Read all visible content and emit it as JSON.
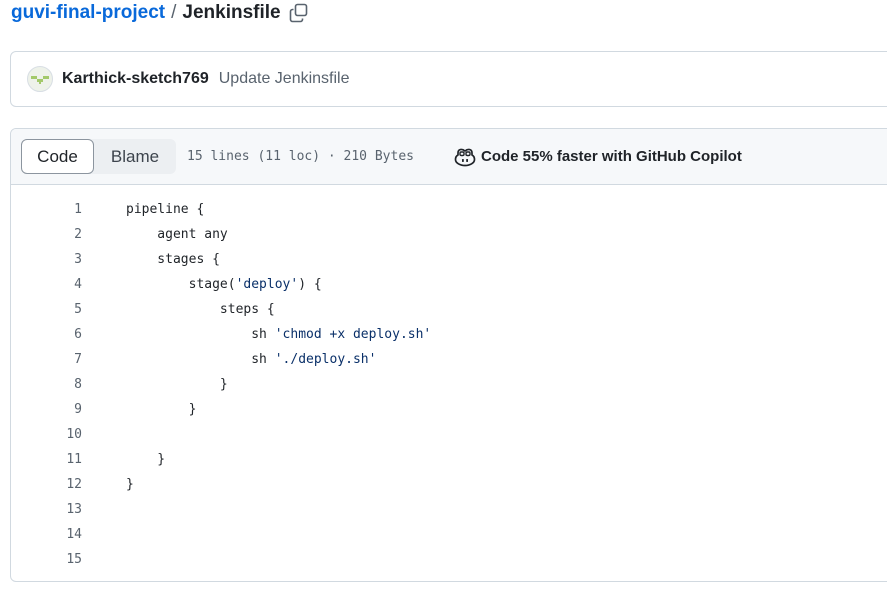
{
  "breadcrumb": {
    "repo": "guvi-final-project",
    "separator": "/",
    "file": "Jenkinsfile"
  },
  "commit": {
    "author": "Karthick-sketch769",
    "message": "Update Jenkinsfile"
  },
  "file_header": {
    "tabs": [
      "Code",
      "Blame"
    ],
    "active_tab": "Code",
    "meta": "15 lines (11 loc) · 210 Bytes",
    "copilot": "Code 55% faster with GitHub Copilot"
  },
  "code_lines": [
    {
      "n": "1",
      "parts": [
        {
          "t": "pipeline {"
        }
      ]
    },
    {
      "n": "2",
      "parts": [
        {
          "t": "    agent any"
        }
      ]
    },
    {
      "n": "3",
      "parts": [
        {
          "t": "    stages {"
        }
      ]
    },
    {
      "n": "4",
      "parts": [
        {
          "t": "        stage("
        },
        {
          "t": "'deploy'",
          "s": true
        },
        {
          "t": ") {"
        }
      ]
    },
    {
      "n": "5",
      "parts": [
        {
          "t": "            steps {"
        }
      ]
    },
    {
      "n": "6",
      "parts": [
        {
          "t": "                sh "
        },
        {
          "t": "'chmod +x deploy.sh'",
          "s": true
        }
      ]
    },
    {
      "n": "7",
      "parts": [
        {
          "t": "                sh "
        },
        {
          "t": "'./deploy.sh'",
          "s": true
        }
      ]
    },
    {
      "n": "8",
      "parts": [
        {
          "t": "            }"
        }
      ]
    },
    {
      "n": "9",
      "parts": [
        {
          "t": "        }"
        }
      ]
    },
    {
      "n": "10",
      "parts": [
        {
          "t": ""
        }
      ]
    },
    {
      "n": "11",
      "parts": [
        {
          "t": "    }"
        }
      ]
    },
    {
      "n": "12",
      "parts": [
        {
          "t": "}"
        }
      ]
    },
    {
      "n": "13",
      "parts": [
        {
          "t": ""
        }
      ]
    },
    {
      "n": "14",
      "parts": [
        {
          "t": ""
        }
      ]
    },
    {
      "n": "15",
      "parts": [
        {
          "t": ""
        }
      ]
    }
  ],
  "colors": {
    "link": "#0969da",
    "string": "#0a3069",
    "muted": "#59636e",
    "border": "#d1d9e0"
  }
}
